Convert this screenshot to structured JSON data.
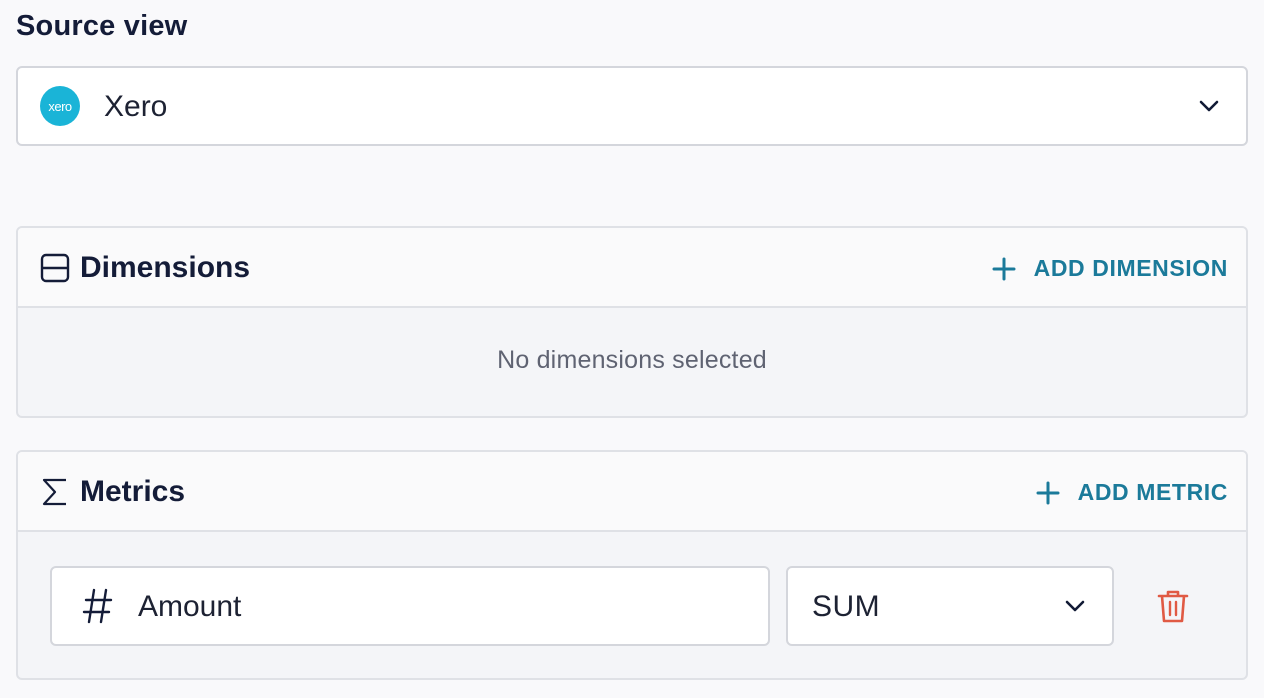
{
  "source": {
    "title": "Source view",
    "selected": "Xero",
    "logo_text": "xero",
    "logo_color": "#1ab4d7"
  },
  "dimensions": {
    "title": "Dimensions",
    "add_label": "ADD DIMENSION",
    "empty_text": "No dimensions selected"
  },
  "metrics": {
    "title": "Metrics",
    "add_label": "ADD METRIC",
    "items": [
      {
        "name": "Amount",
        "type_icon": "hash-icon",
        "aggregation": "SUM"
      }
    ]
  },
  "colors": {
    "accent": "#1b7a9a",
    "danger": "#e05a44",
    "text": "#141c38"
  }
}
